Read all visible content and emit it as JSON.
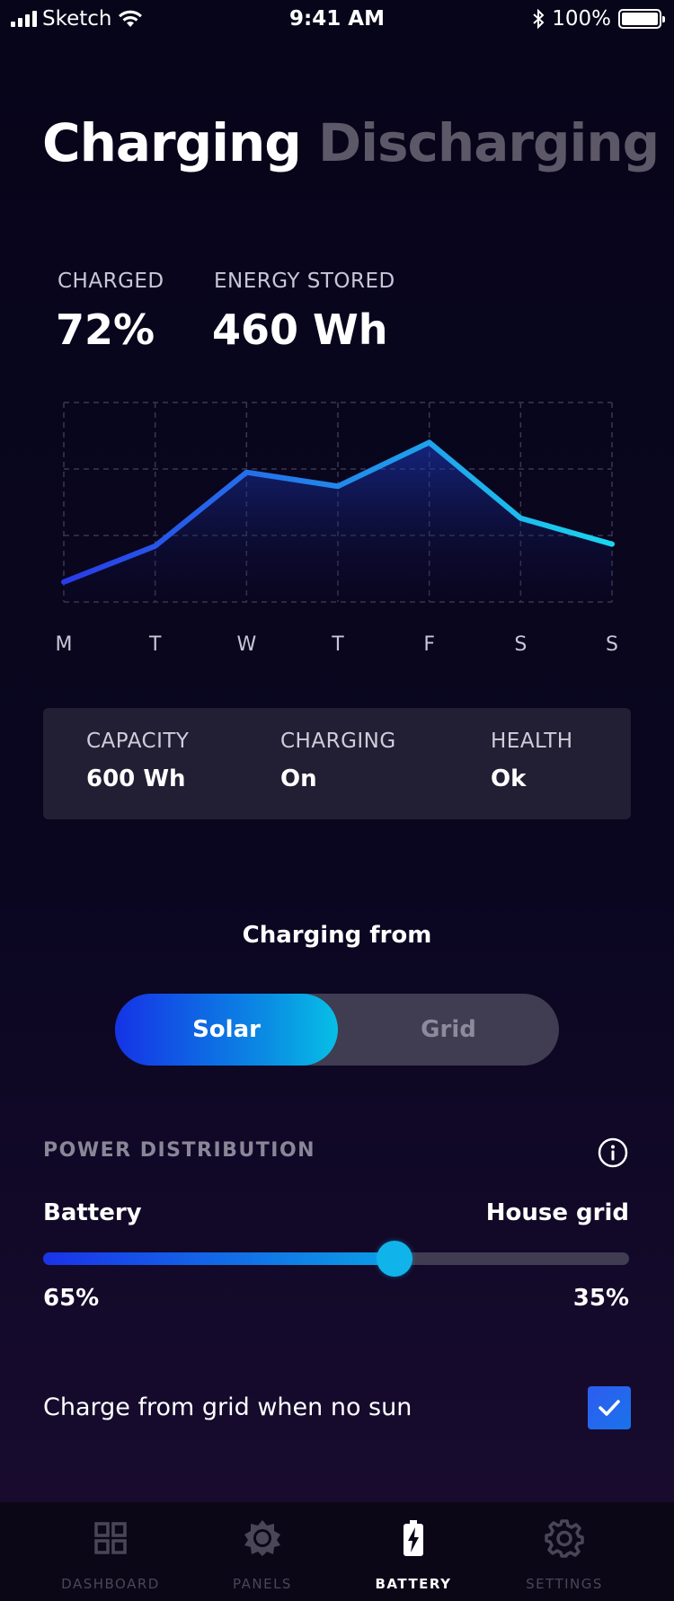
{
  "status_bar": {
    "carrier": "Sketch",
    "time": "9:41 AM",
    "battery_pct": "100%"
  },
  "tabs": {
    "active": "Charging",
    "inactive": "Discharging"
  },
  "stats": {
    "charged_label": "CHARGED",
    "charged_value": "72%",
    "energy_label": "ENERGY STORED",
    "energy_value": "460 Wh"
  },
  "chart_data": {
    "type": "area",
    "categories": [
      "M",
      "T",
      "W",
      "T",
      "F",
      "S",
      "S"
    ],
    "values": [
      0.1,
      0.28,
      0.65,
      0.58,
      0.8,
      0.42,
      0.29
    ],
    "ylim": [
      0,
      1
    ],
    "grid": true,
    "colors": {
      "line_start": "#2a3be8",
      "line_end": "#19d6ee"
    }
  },
  "info_card": {
    "capacity_label": "CAPACITY",
    "capacity_value": "600 Wh",
    "charging_label": "CHARGING",
    "charging_value": "On",
    "health_label": "HEALTH",
    "health_value": "Ok"
  },
  "charging_from": {
    "title": "Charging from",
    "option_selected": "Solar",
    "option_other": "Grid"
  },
  "power_distribution": {
    "title": "POWER DISTRIBUTION",
    "info_icon": "info-icon",
    "left_label": "Battery",
    "right_label": "House grid",
    "left_pct": "65%",
    "right_pct": "35%",
    "slider_value": 0.6
  },
  "option": {
    "label": "Charge from grid when no sun",
    "checked": true
  },
  "nav": {
    "items": [
      {
        "label": "DASHBOARD",
        "icon": "grid-icon",
        "active": false
      },
      {
        "label": "PANELS",
        "icon": "sun-icon",
        "active": false
      },
      {
        "label": "BATTERY",
        "icon": "battery-bolt-icon",
        "active": true
      },
      {
        "label": "SETTINGS",
        "icon": "gear-icon",
        "active": false
      }
    ]
  },
  "colors": {
    "accent": "#0bb4ea",
    "accent_blue": "#1a33e8",
    "card_bg": "#221e33",
    "muted": "#5c5868"
  }
}
